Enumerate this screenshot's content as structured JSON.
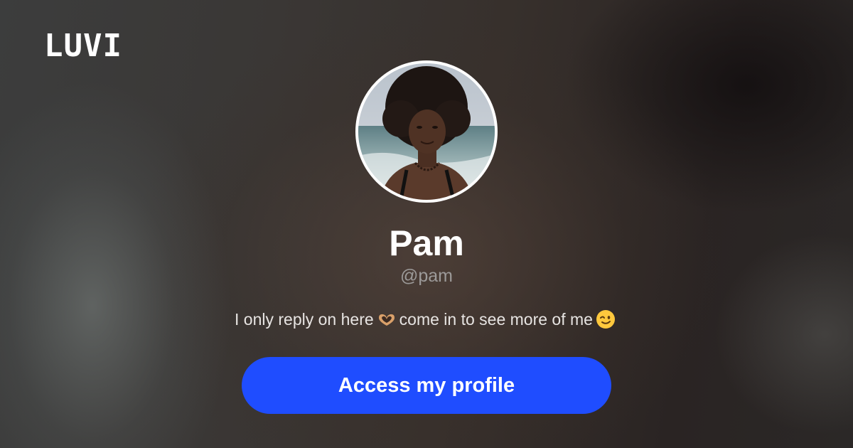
{
  "brand": {
    "logo_text": "LUVI"
  },
  "profile": {
    "name": "Pam",
    "handle": "@pam",
    "avatar_icon": "profile-photo",
    "bio": {
      "part1": "I only reply on here",
      "emoji1": "heart-hands-emoji",
      "part2": "come in to see more of me",
      "emoji2": "winking-face-emoji"
    }
  },
  "cta": {
    "label": "Access my profile",
    "color": "#1f4dff"
  },
  "colors": {
    "name_text": "#ffffff",
    "handle_text": "#9c9a99",
    "bio_text": "#e7e4e2"
  }
}
